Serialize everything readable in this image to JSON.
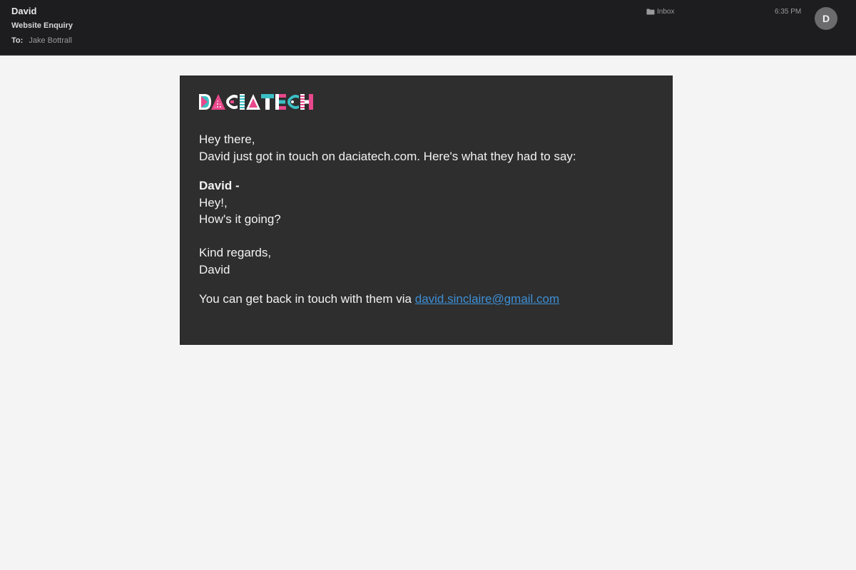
{
  "header": {
    "sender": "David",
    "subject": "Website Enquiry",
    "to_label": "To:",
    "to_value": "Jake Bottrall",
    "folder": "Inbox",
    "time": "6:35 PM",
    "avatar_initial": "D"
  },
  "email": {
    "logo_text": "DACIATECH",
    "greeting": "Hey there,",
    "intro": "David just got in touch on daciatech.com. Here's what they had to say:",
    "message_author": "David -",
    "message_lines": [
      "Hey!,",
      "How's it going?"
    ],
    "signoff": "Kind regards,",
    "signature": "David",
    "contact_prefix": "You can get back in touch with them via ",
    "contact_email": "david.sinclaire@gmail.com"
  },
  "colors": {
    "header_bg": "#1d1d1f",
    "page_bg": "#f4f4f4",
    "card_bg": "#2e2e2e",
    "link": "#3d8fd6",
    "logo_pink": "#e8478b",
    "logo_teal": "#3bbfc4"
  },
  "icons": {
    "folder": "folder-icon"
  }
}
